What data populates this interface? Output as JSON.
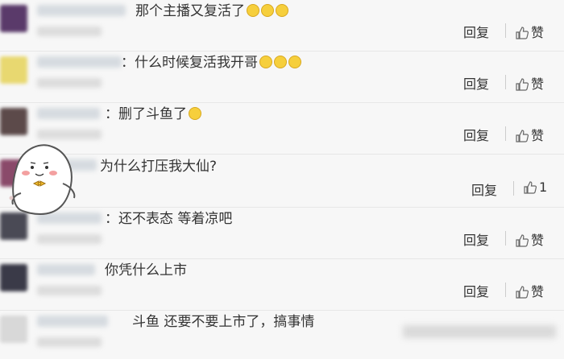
{
  "comments": [
    {
      "text": "那个主播又复活了",
      "emoji_count": 3,
      "reply": "回复",
      "like": "赞"
    },
    {
      "text": "：什么时候复活我开哥",
      "emoji_count": 3,
      "reply": "回复",
      "like": "赞"
    },
    {
      "text": "：删了斗鱼了",
      "emoji_count": 1,
      "reply": "回复",
      "like": "赞"
    },
    {
      "text": "为什么打压我大仙?",
      "emoji_count": 0,
      "reply": "回复",
      "like": "1"
    },
    {
      "text": "：还不表态 等着凉吧",
      "emoji_count": 0,
      "reply": "回复",
      "like": "赞"
    },
    {
      "text": "你凭什么上市",
      "emoji_count": 0,
      "reply": "回复",
      "like": "赞"
    },
    {
      "text": "斗鱼 还要不要上市了，搞事情",
      "emoji_count": 0
    }
  ],
  "colors": {
    "avatars": [
      "#5a3a6a",
      "#e8d870",
      "#5c4a4a",
      "#8a4a6a",
      "#4a4a55",
      "#3a3a48",
      "#d8d8d8"
    ]
  }
}
